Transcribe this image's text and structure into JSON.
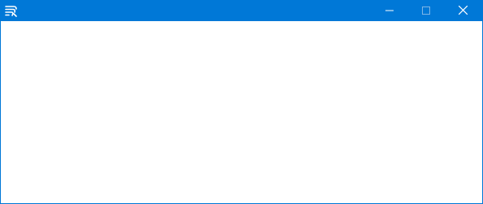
{
  "window": {
    "title": "",
    "accent_color": "#0078d7",
    "app_icon": "app-logo-icon",
    "controls": {
      "minimize_icon": "minimize-icon",
      "maximize_icon": "maximize-icon",
      "maximize_enabled": false,
      "close_icon": "close-icon"
    }
  }
}
